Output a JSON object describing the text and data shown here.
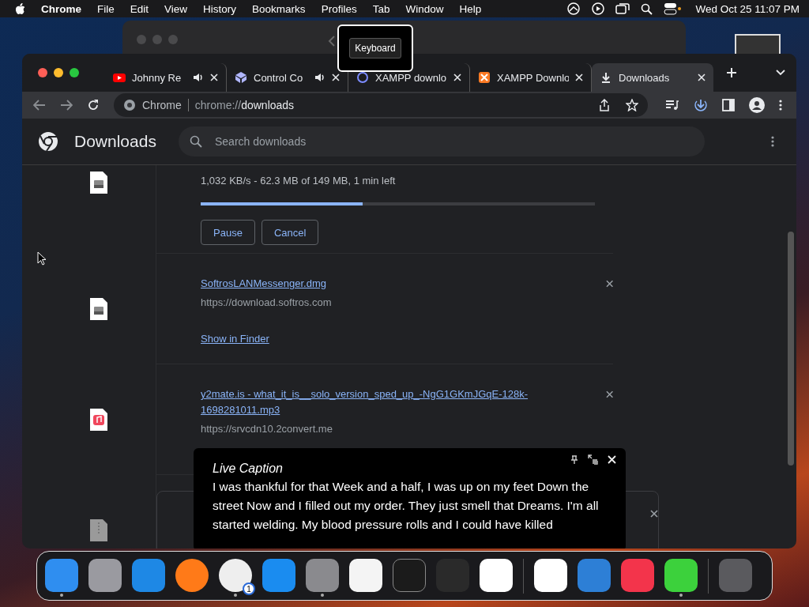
{
  "menu_bar": {
    "app": "Chrome",
    "items": [
      "File",
      "Edit",
      "View",
      "History",
      "Bookmarks",
      "Profiles",
      "Tab",
      "Window",
      "Help"
    ],
    "clock": "Wed Oct 25  11:07 PM"
  },
  "tooltip": {
    "text": "Keyboard"
  },
  "browser": {
    "tabs": [
      {
        "title": "Johnny Re",
        "kind": "video",
        "audio": true,
        "selected": false
      },
      {
        "title": "Control Co",
        "kind": "cube",
        "audio": true,
        "selected": false
      },
      {
        "title": "XAMPP downlo",
        "kind": "spiral",
        "audio": false,
        "selected": false
      },
      {
        "title": "XAMPP Downlo",
        "kind": "xampp",
        "audio": false,
        "selected": false
      },
      {
        "title": "Downloads",
        "kind": "download",
        "audio": false,
        "selected": true
      }
    ],
    "address": {
      "site": "Chrome",
      "url_prefix": "chrome://",
      "url_host": "downloads"
    }
  },
  "downloads_page": {
    "title": "Downloads",
    "search": {
      "placeholder": "Search downloads"
    },
    "items": [
      {
        "kind": "progress",
        "status": "1,032 KB/s - 62.3 MB of 149 MB, 1 min left",
        "level": 0.41,
        "buttons": [
          "Pause",
          "Cancel"
        ]
      },
      {
        "kind": "disk",
        "file": "SoftrosLANMessenger.dmg",
        "url": "https://download.softros.com",
        "action": "Show in Finder"
      },
      {
        "kind": "audio",
        "file": "y2mate.is - what_it_is__solo_version_sped_up_-NgG1GKmJGqE-128k-1698281011.mp3",
        "url": "https://srvcdn10.2convert.me"
      },
      {
        "kind": "partial"
      }
    ]
  },
  "live_caption": {
    "title": "Live Caption",
    "text": " I was thankful for that Week and a half, I was up on my feet Down the street Now and I filled out my order. They just smell that Dreams. I'm all started welding. My blood pressure rolls and I could have killed"
  },
  "dock": [
    {
      "kind": "finder",
      "running": true
    },
    {
      "kind": "launchpad",
      "running": false
    },
    {
      "kind": "safari",
      "running": false
    },
    {
      "kind": "firefox",
      "running": false
    },
    {
      "kind": "chrome",
      "running": true,
      "badge": "1"
    },
    {
      "kind": "appstore",
      "running": false
    },
    {
      "kind": "settings",
      "running": true
    },
    {
      "kind": "textedit",
      "running": false
    },
    {
      "kind": "terminal",
      "running": false
    },
    {
      "kind": "garageband",
      "running": false
    },
    {
      "kind": "vscode",
      "running": false
    },
    {
      "kind": "separator"
    },
    {
      "kind": "visualstudio",
      "running": false
    },
    {
      "kind": "weather",
      "running": false
    },
    {
      "kind": "music",
      "running": false
    },
    {
      "kind": "archive",
      "running": true
    },
    {
      "kind": "separator"
    },
    {
      "kind": "trash",
      "running": false
    }
  ]
}
